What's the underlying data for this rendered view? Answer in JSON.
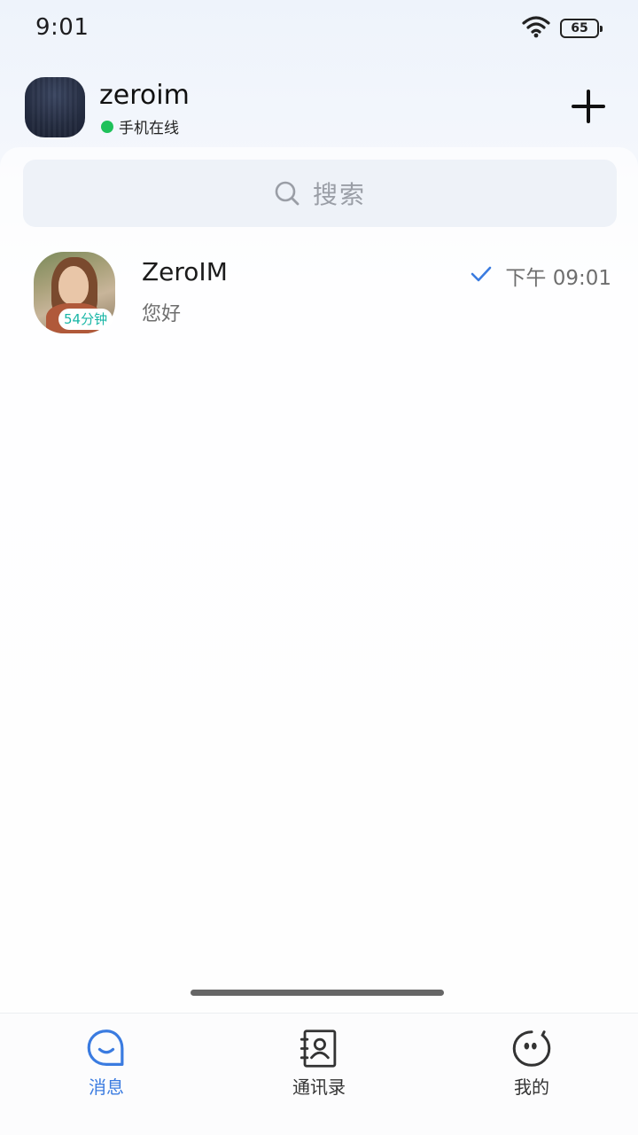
{
  "status_bar": {
    "time": "9:01",
    "battery": "65",
    "wifi_icon": "wifi-icon"
  },
  "header": {
    "username": "zeroim",
    "online_status": "手机在线",
    "online_color": "#1fc15a",
    "add_icon": "plus-icon"
  },
  "search": {
    "placeholder": "搜索",
    "icon": "search-icon"
  },
  "conversations": [
    {
      "name": "ZeroIM",
      "preview": "您好",
      "time": "下午 09:01",
      "badge": "54分钟",
      "read_icon": "check-icon"
    }
  ],
  "nav": {
    "items": [
      {
        "label": "消息",
        "icon": "chat-bubble-icon",
        "active": true
      },
      {
        "label": "通讯录",
        "icon": "contacts-book-icon",
        "active": false
      },
      {
        "label": "我的",
        "icon": "profile-face-icon",
        "active": false
      }
    ],
    "active_color": "#3a7be0"
  }
}
